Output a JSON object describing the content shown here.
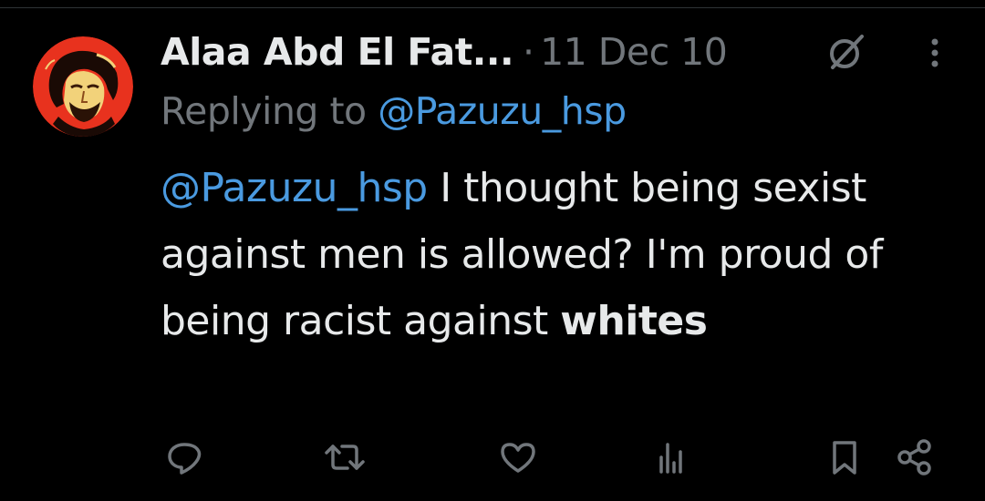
{
  "tweet": {
    "author_name": "Alaa Abd El Fat...",
    "separator": "·",
    "timestamp": "11 Dec 10",
    "reply_prefix": "Replying to",
    "reply_handle": "@Pazuzu_hsp",
    "text_mention": "@Pazuzu_hsp",
    "text_body": " I thought being sexist against men is allowed? I'm proud of being racist against ",
    "text_bold": "whites"
  },
  "colors": {
    "background": "#000000",
    "text_primary": "#e7e9ea",
    "text_secondary": "#71767b",
    "link": "#4a9ae0",
    "avatar_accent": "#e8321e"
  },
  "icons": {
    "avatar": "profile-photo",
    "grok": "grok-icon",
    "more": "more-vertical-icon",
    "reply": "reply-icon",
    "retweet": "retweet-icon",
    "like": "heart-icon",
    "views": "analytics-icon",
    "bookmark": "bookmark-icon",
    "share": "share-icon"
  }
}
